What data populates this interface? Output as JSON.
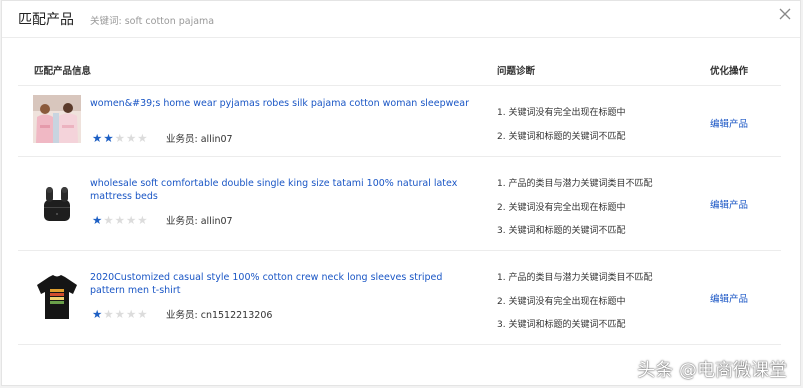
{
  "dialog": {
    "title": "匹配产品",
    "keyword_text": "关键词: soft cotton pajama"
  },
  "table": {
    "headers": {
      "product_info": "匹配产品信息",
      "diagnosis": "问题诊断",
      "action": "优化操作"
    },
    "rows": [
      {
        "name": "women&#39;s home wear pyjamas robes silk pajama cotton woman sleepwear",
        "rating": 2,
        "salesperson": "业务员: allin07",
        "issues": [
          "1. 关键词没有完全出现在标题中",
          "2. 关键词和标题的关键词不匹配"
        ],
        "action_label": "编辑产品",
        "thumb_icon": "pajama-photo"
      },
      {
        "name": "wholesale soft comfortable double single king size tatami 100% natural latex mattress beds",
        "rating": 1,
        "salesperson": "业务员: allin07",
        "issues": [
          "1. 产品的类目与潜力关键词类目不匹配",
          "2. 关键词没有完全出现在标题中",
          "3. 关键词和标题的关键词不匹配"
        ],
        "action_label": "编辑产品",
        "thumb_icon": "earbuds-photo"
      },
      {
        "name": "2020Customized casual style 100% cotton crew neck long sleeves striped pattern men t-shirt",
        "rating": 1,
        "salesperson": "业务员: cn1512213206",
        "issues": [
          "1. 产品的类目与潜力关键词类目不匹配",
          "2. 关键词没有完全出现在标题中",
          "3. 关键词和标题的关键词不匹配"
        ],
        "action_label": "编辑产品",
        "thumb_icon": "tshirt-photo"
      }
    ]
  },
  "watermark": "头条 @电商微课堂",
  "colors": {
    "link": "#1a56c5",
    "star_on": "#1d5fc4",
    "star_off": "#dcdcdc"
  }
}
